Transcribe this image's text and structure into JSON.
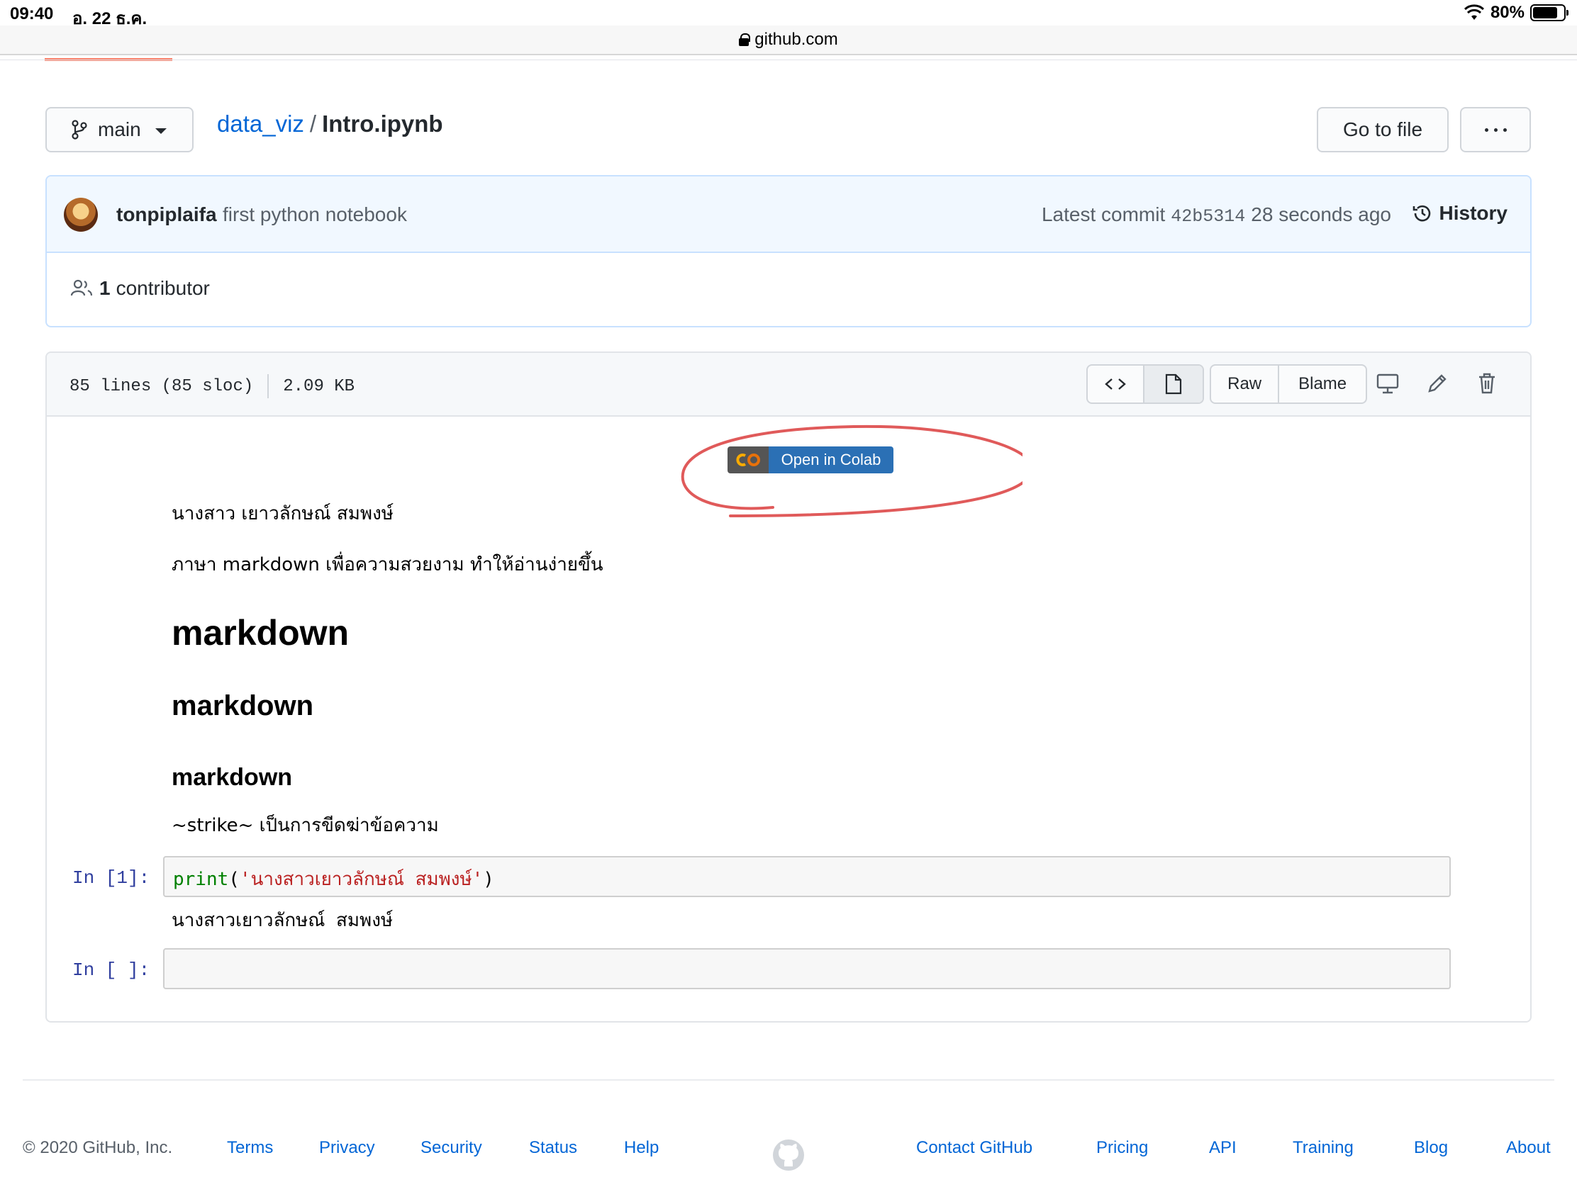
{
  "status_bar": {
    "time": "09:40",
    "date": "อ. 22 ธ.ค.",
    "battery": "80%",
    "battery_level": 0.8
  },
  "address_bar": {
    "domain": "github.com"
  },
  "repo_header": {
    "branch": "main",
    "repo": "data_viz",
    "separator": "/",
    "file": "Intro.ipynb",
    "goto_file": "Go to file"
  },
  "commit": {
    "author": "tonpiplaifa",
    "message": "first python notebook",
    "latest_label": "Latest commit",
    "sha": "42b5314",
    "age": "28 seconds ago",
    "history": "History",
    "contributors_count": "1",
    "contributors_label": "contributor"
  },
  "file": {
    "lines": "85 lines (85 sloc)",
    "size": "2.09 KB",
    "raw": "Raw",
    "blame": "Blame"
  },
  "notebook": {
    "colab_badge": "Open in Colab",
    "para1": "นางสาว เยาวลักษณ์ สมพงษ์",
    "para2": "ภาษา markdown เพื่อความสวยงาม ทำให้อ่านง่ายขึ้น",
    "h1": "markdown",
    "h2": "markdown",
    "h3": "markdown",
    "strike_para": "~strike~ เป็นการขีดฆ่าข้อความ",
    "cell1_prompt": "In [1]:",
    "cell1_fn": "print",
    "cell1_open": "(",
    "cell1_str": "'นางสาวเยาวลักษณ์ สมพงษ์'",
    "cell1_close": ")",
    "cell1_output": "นางสาวเยาวลักษณ์ สมพงษ์",
    "cell2_prompt": "In [ ]:"
  },
  "footer": {
    "copyright": "© 2020 GitHub, Inc.",
    "links": [
      "Terms",
      "Privacy",
      "Security",
      "Status",
      "Help",
      "Contact GitHub",
      "Pricing",
      "API",
      "Training",
      "Blog",
      "About"
    ]
  },
  "colors": {
    "link": "#0366d6",
    "annotation": "#e05a5a",
    "colab_blue": "#2b70b5",
    "commit_bg": "#f1f8ff"
  }
}
